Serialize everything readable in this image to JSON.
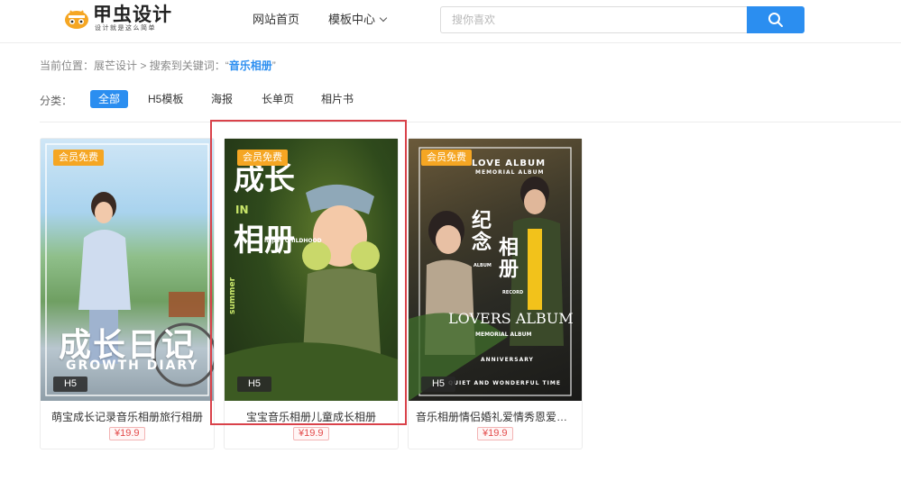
{
  "header": {
    "logo_title": "甲虫设计",
    "logo_slogan": "设计就是这么简单",
    "nav_home": "网站首页",
    "nav_templates": "模板中心",
    "search_placeholder": "搜你喜欢"
  },
  "breadcrumb": {
    "prefix": "当前位置：",
    "home": "展芒设计",
    "separator": " > ",
    "search_text": "搜索到关键词：",
    "keyword": "音乐相册",
    "quote_open": "“",
    "quote_close": "”"
  },
  "filters": {
    "label": "分类：",
    "items": [
      "全部",
      "H5模板",
      "海报",
      "长单页",
      "相片书"
    ],
    "active": "全部"
  },
  "cards": [
    {
      "badge": "会员免费",
      "type": "H5",
      "title": "萌宝成长记录音乐相册旅行相册",
      "price": "¥19.9",
      "poster_title": "成长日记",
      "poster_subtitle": "GROWTH DIARY"
    },
    {
      "badge": "会员免费",
      "type": "H5",
      "title": "宝宝音乐相册儿童成长相册",
      "price": "¥19.9",
      "poster_title_a": "成长",
      "poster_title_b": "相册",
      "poster_in": "IN",
      "poster_sub": "happy CHILDHOOD",
      "poster_season": "summer"
    },
    {
      "badge": "会员免费",
      "type": "H5",
      "title": "音乐相册情侣婚礼爱情秀恩爱表...",
      "price": "¥19.9",
      "poster_top": "LOVE ALBUM",
      "poster_memorial": "MEMORIAL ALBUM",
      "poster_title_a": "纪念",
      "poster_title_b": "相册",
      "poster_album": "ALBUM",
      "poster_record": "RECORD",
      "poster_lovers": "LOVERS ALBUM",
      "poster_anniversary": "ANNIVERSARY",
      "poster_bottom": "QUIET AND WONDERFUL TIME"
    }
  ],
  "colors": {
    "accent": "#2b8ef0",
    "vip_badge": "#f5a623",
    "price": "#e34b4b",
    "highlight": "#d9424a"
  }
}
